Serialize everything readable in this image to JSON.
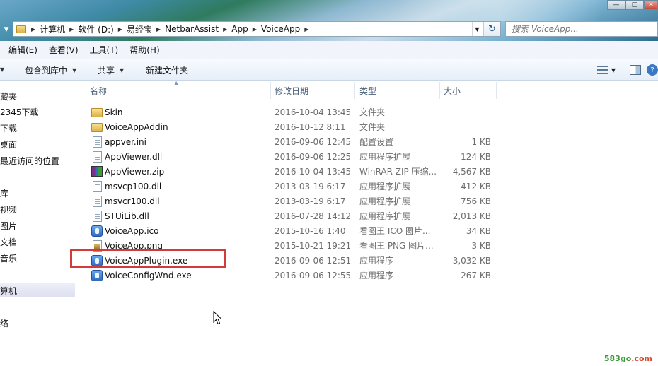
{
  "window": {
    "controls": {
      "minimize": "—",
      "maximize": "□",
      "close": "✕"
    }
  },
  "address": {
    "crumbs": [
      "计算机",
      "软件 (D:)",
      "易经宝",
      "NetbarAssist",
      "App",
      "VoiceApp"
    ],
    "refresh_icon": "refresh-icon"
  },
  "search": {
    "placeholder": "搜索 VoiceApp..."
  },
  "menu": [
    "编辑(E)",
    "查看(V)",
    "工具(T)",
    "帮助(H)"
  ],
  "toolbar": {
    "include_library": "包含到库中",
    "share": "共享",
    "new_folder": "新建文件夹"
  },
  "navpane": {
    "items": [
      "藏夹",
      "2345下载",
      "下载",
      "桌面",
      "最近访问的位置",
      "库",
      "视频",
      "图片",
      "文档",
      "音乐",
      "算机",
      "络"
    ]
  },
  "columns": {
    "name": "名称",
    "date": "修改日期",
    "type": "类型",
    "size": "大小"
  },
  "files": [
    {
      "name": "Skin",
      "date": "2016-10-04 13:45",
      "type": "文件夹",
      "size": "",
      "icon": "folder"
    },
    {
      "name": "VoiceAppAddin",
      "date": "2016-10-12 8:11",
      "type": "文件夹",
      "size": "",
      "icon": "folder"
    },
    {
      "name": "appver.ini",
      "date": "2016-09-06 12:45",
      "type": "配置设置",
      "size": "1 KB",
      "icon": "doc"
    },
    {
      "name": "AppViewer.dll",
      "date": "2016-09-06 12:25",
      "type": "应用程序扩展",
      "size": "124 KB",
      "icon": "doc"
    },
    {
      "name": "AppViewer.zip",
      "date": "2016-10-04 13:45",
      "type": "WinRAR ZIP 压缩...",
      "size": "4,567 KB",
      "icon": "rar"
    },
    {
      "name": "msvcp100.dll",
      "date": "2013-03-19 6:17",
      "type": "应用程序扩展",
      "size": "412 KB",
      "icon": "doc"
    },
    {
      "name": "msvcr100.dll",
      "date": "2013-03-19 6:17",
      "type": "应用程序扩展",
      "size": "756 KB",
      "icon": "doc"
    },
    {
      "name": "STUiLib.dll",
      "date": "2016-07-28 14:12",
      "type": "应用程序扩展",
      "size": "2,013 KB",
      "icon": "doc"
    },
    {
      "name": "VoiceApp.ico",
      "date": "2015-10-16 1:40",
      "type": "看图王 ICO 图片...",
      "size": "34 KB",
      "icon": "app"
    },
    {
      "name": "VoiceApp.png",
      "date": "2015-10-21 19:21",
      "type": "看图王 PNG 图片...",
      "size": "3 KB",
      "icon": "png"
    },
    {
      "name": "VoiceAppPlugin.exe",
      "date": "2016-09-06 12:51",
      "type": "应用程序",
      "size": "3,032 KB",
      "icon": "app"
    },
    {
      "name": "VoiceConfigWnd.exe",
      "date": "2016-09-06 12:55",
      "type": "应用程序",
      "size": "267 KB",
      "icon": "app"
    }
  ],
  "watermark": {
    "part1": "583go",
    "part2": ".com"
  }
}
